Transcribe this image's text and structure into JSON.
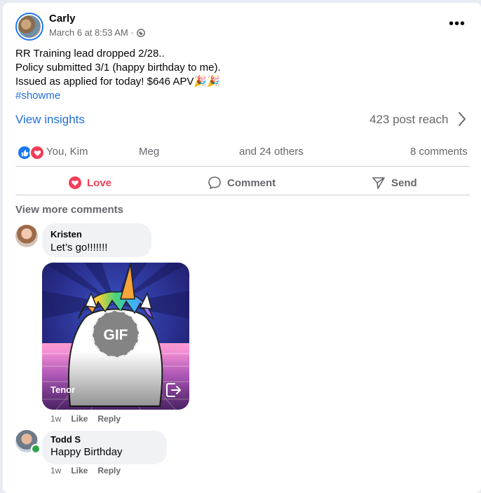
{
  "post": {
    "author": "Carly",
    "meta": "March 6 at 8:53 AM ·",
    "menu_label": "•••",
    "lines": [
      "RR Training lead dropped 2/28..",
      "Policy submitted 3/1 (happy birthday to me).",
      "Issued as applied for today! $646 APV"
    ],
    "party_emoji": "🎉🎉",
    "hashtag": "#showme"
  },
  "insights": {
    "link": "View insights",
    "reach": "423 post reach"
  },
  "reactions": {
    "names_a": "You, Kim",
    "names_b": "Meg",
    "others": "and 24 others",
    "comments": "8 comments"
  },
  "actions": {
    "love": "Love",
    "comment": "Comment",
    "send": "Send"
  },
  "comments_section": {
    "view_more": "View more comments",
    "items": [
      {
        "name": "Kristen",
        "text": "Let’s go!!!!!!!",
        "gif_badge": "GIF",
        "gif_source": "Tenor",
        "time": "1w",
        "like": "Like",
        "reply": "Reply"
      },
      {
        "name": "Todd S",
        "text": "Happy Birthday",
        "time": "1w",
        "like": "Like",
        "reply": "Reply"
      }
    ]
  },
  "colors": {
    "link_blue": "#216fdb",
    "love_red": "#f33e58",
    "muted": "#65676b"
  }
}
